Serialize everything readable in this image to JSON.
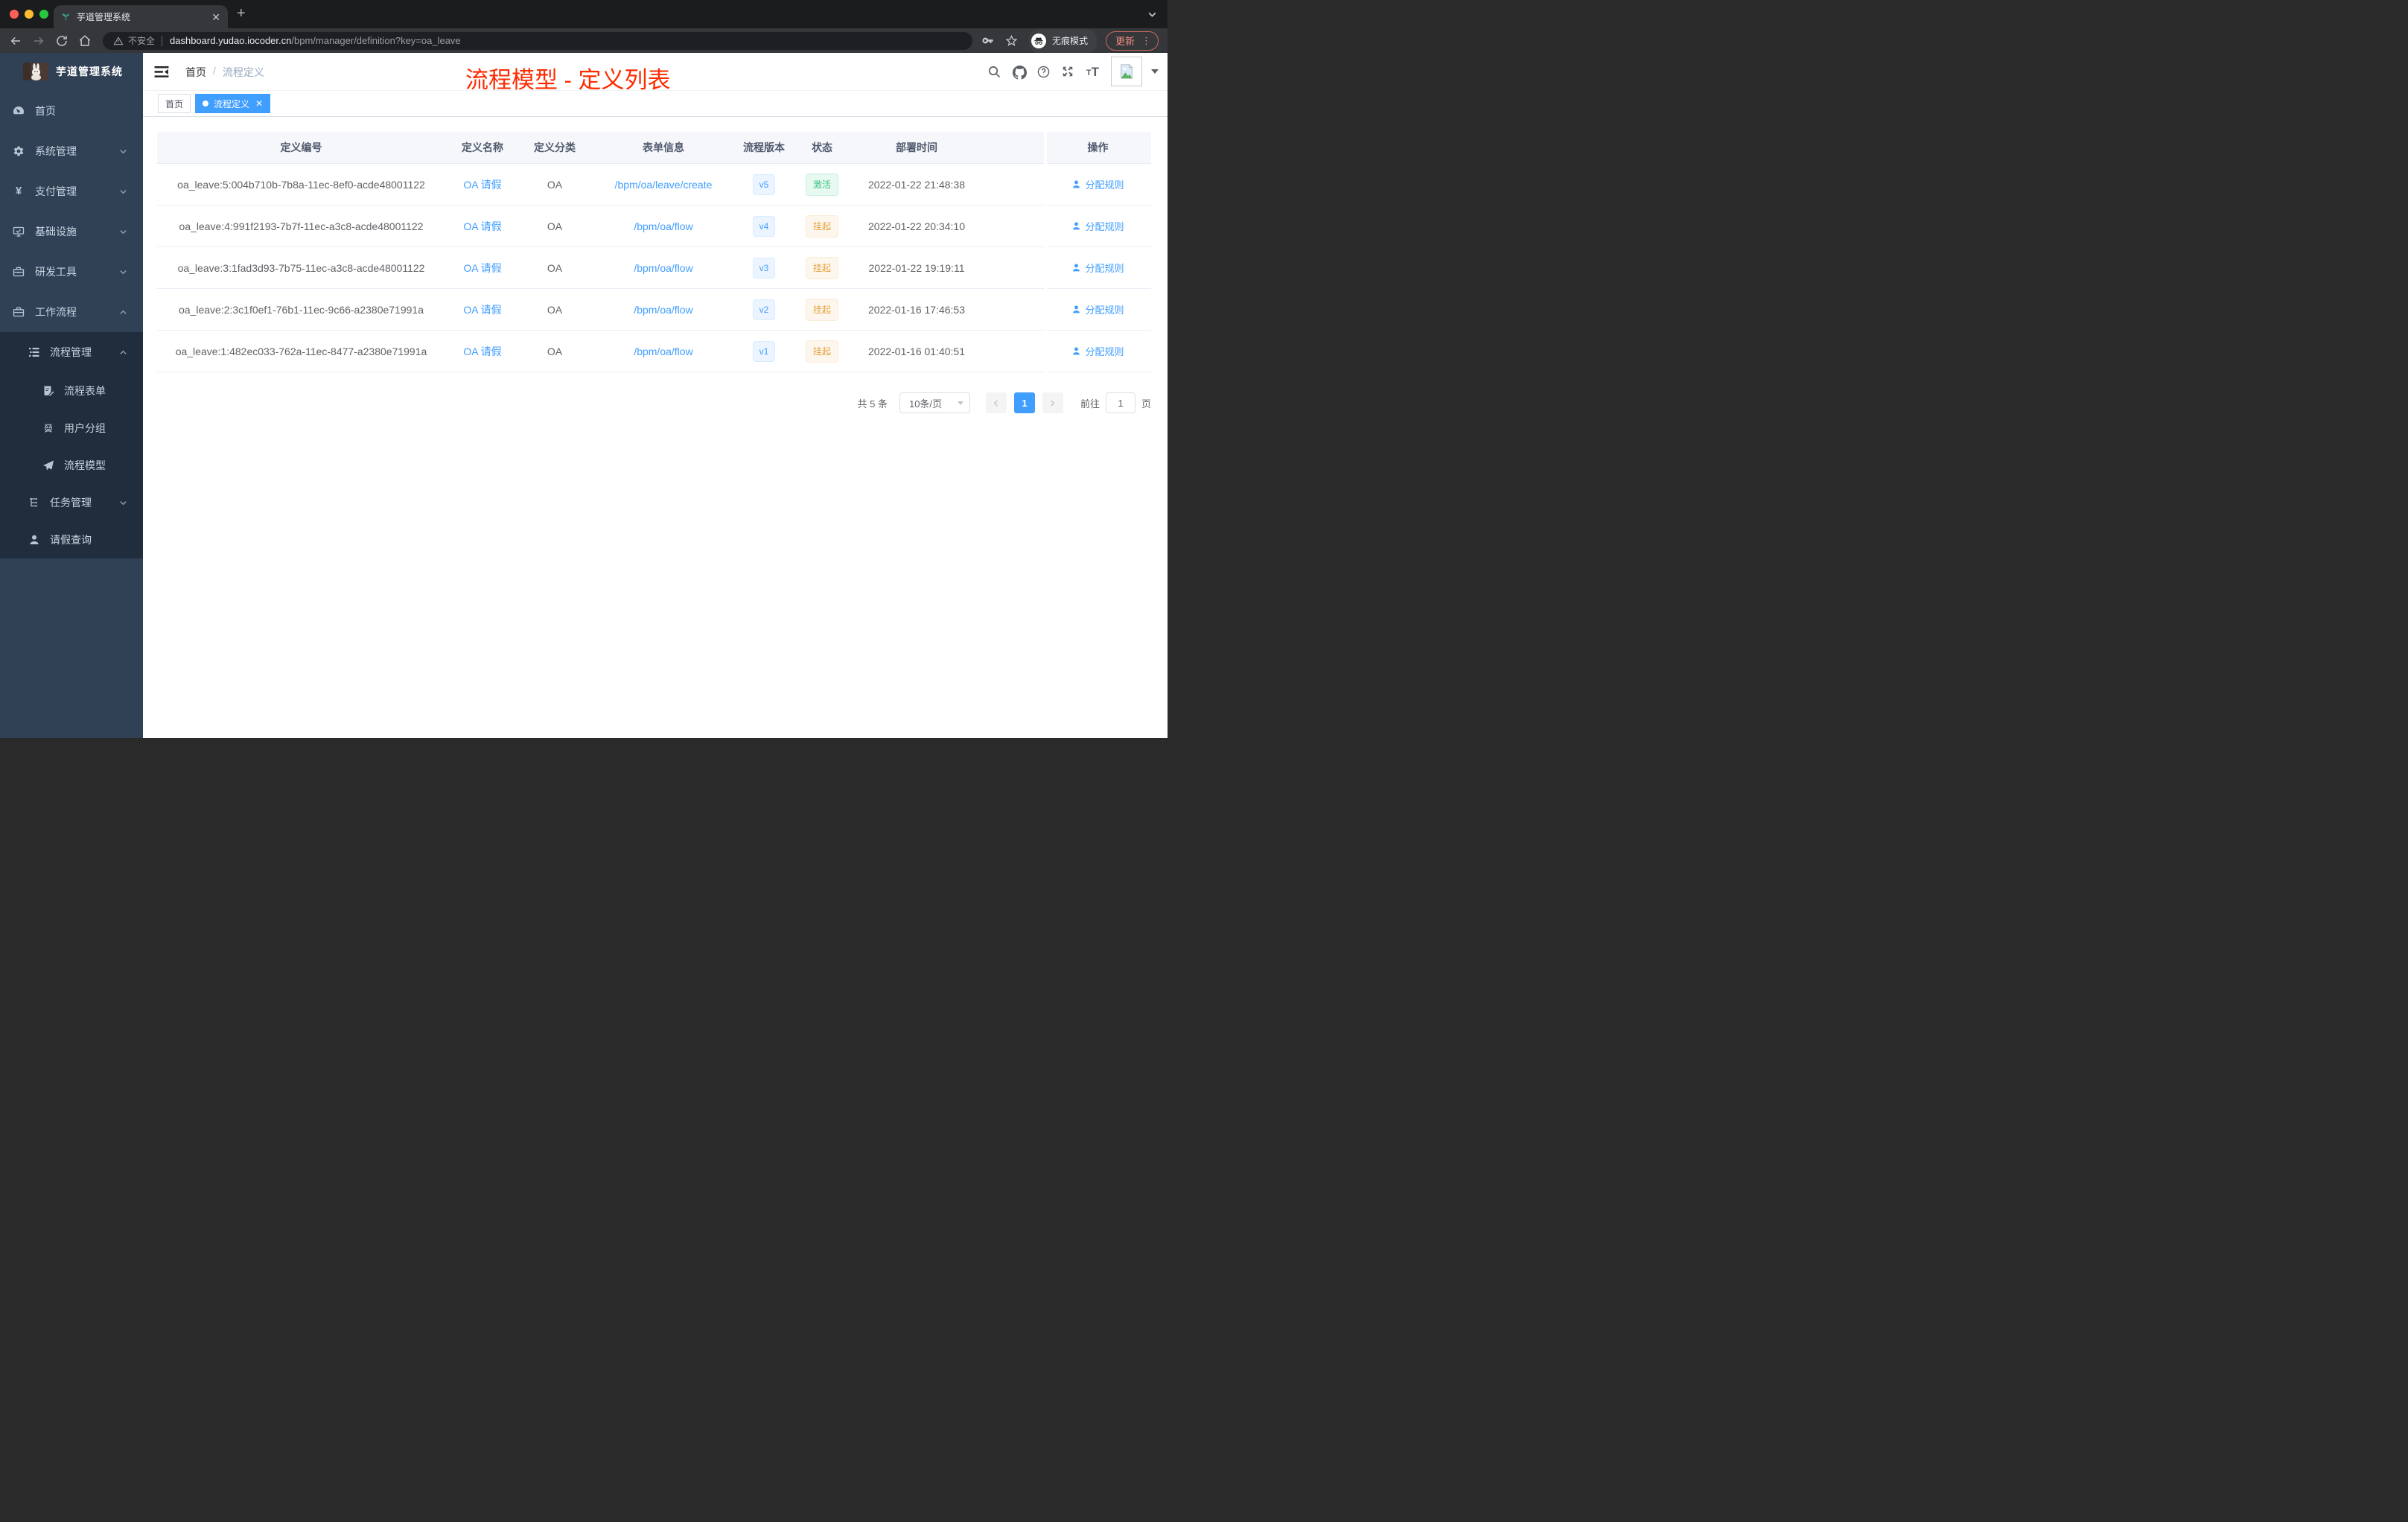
{
  "colors": {
    "accent": "#409eff",
    "success_text": "#3fc380",
    "warning_text": "#e6a23c",
    "annotation_red": "#fe2b01",
    "sidebar_bg": "#304156",
    "submenu_bg": "#1f2d3d"
  },
  "browser": {
    "tab_title": "芋道管理系统",
    "security_label": "不安全",
    "url_domain": "dashboard.yudao.iocoder.cn",
    "url_path": "/bpm/manager/definition?key=oa_leave",
    "incognito_label": "无痕模式",
    "update_label": "更新"
  },
  "sidebar": {
    "app_title": "芋道管理系统",
    "menu": [
      {
        "label": "首页",
        "icon": "dashboard-icon"
      },
      {
        "label": "系统管理",
        "icon": "gear-icon",
        "arrow": "down"
      },
      {
        "label": "支付管理",
        "icon": "yen-icon",
        "arrow": "down"
      },
      {
        "label": "基础设施",
        "icon": "monitor-icon",
        "arrow": "down"
      },
      {
        "label": "研发工具",
        "icon": "toolbox-icon",
        "arrow": "down"
      },
      {
        "label": "工作流程",
        "icon": "briefcase-icon",
        "arrow": "up"
      },
      {
        "label": "流程管理",
        "icon": "list-tree-icon",
        "arrow": "up"
      },
      {
        "label": "流程表单",
        "icon": "form-icon"
      },
      {
        "label": "用户分组",
        "icon": "user-group-icon"
      },
      {
        "label": "流程模型",
        "icon": "paper-plane-icon"
      },
      {
        "label": "任务管理",
        "icon": "task-tree-icon",
        "arrow": "down"
      },
      {
        "label": "请假查询",
        "icon": "person-icon"
      }
    ]
  },
  "navbar": {
    "breadcrumb_home": "首页",
    "breadcrumb_sep": "/",
    "breadcrumb_current": "流程定义",
    "annotation_title": "流程模型 - 定义列表"
  },
  "tags": {
    "home": "首页",
    "active": "流程定义"
  },
  "table": {
    "columns": [
      "定义编号",
      "定义名称",
      "定义分类",
      "表单信息",
      "流程版本",
      "状态",
      "部署时间",
      "操作"
    ],
    "rows": [
      {
        "id": "oa_leave:5:004b710b-7b8a-11ec-8ef0-acde48001122",
        "name": "OA 请假",
        "category": "OA",
        "form": "/bpm/oa/leave/create",
        "version": "v5",
        "status": "激活",
        "deployed": "2022-01-22 21:48:38",
        "action": "分配规则"
      },
      {
        "id": "oa_leave:4:991f2193-7b7f-11ec-a3c8-acde48001122",
        "name": "OA 请假",
        "category": "OA",
        "form": "/bpm/oa/flow",
        "version": "v4",
        "status": "挂起",
        "deployed": "2022-01-22 20:34:10",
        "action": "分配规则"
      },
      {
        "id": "oa_leave:3:1fad3d93-7b75-11ec-a3c8-acde48001122",
        "name": "OA 请假",
        "category": "OA",
        "form": "/bpm/oa/flow",
        "version": "v3",
        "status": "挂起",
        "deployed": "2022-01-22 19:19:11",
        "action": "分配规则"
      },
      {
        "id": "oa_leave:2:3c1f0ef1-76b1-11ec-9c66-a2380e71991a",
        "name": "OA 请假",
        "category": "OA",
        "form": "/bpm/oa/flow",
        "version": "v2",
        "status": "挂起",
        "deployed": "2022-01-16 17:46:53",
        "action": "分配规则"
      },
      {
        "id": "oa_leave:1:482ec033-762a-11ec-8477-a2380e71991a",
        "name": "OA 请假",
        "category": "OA",
        "form": "/bpm/oa/flow",
        "version": "v1",
        "status": "挂起",
        "deployed": "2022-01-16 01:40:51",
        "action": "分配规则"
      }
    ]
  },
  "pagination": {
    "total_label": "共 5 条",
    "page_size_label": "10条/页",
    "current_page": "1",
    "goto_label": "前往",
    "goto_value": "1",
    "unit_label": "页"
  }
}
